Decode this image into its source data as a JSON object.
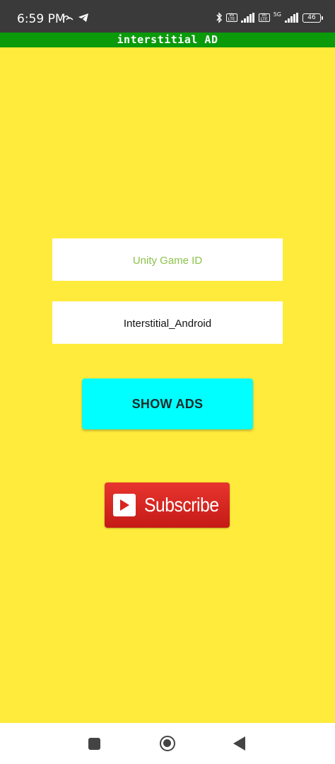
{
  "status_bar": {
    "time": "6:59 PM",
    "battery": "46",
    "network": "5G",
    "volte": "Vo LTE",
    "icons": [
      "signal-alt-icon",
      "telegram-icon",
      "bluetooth-icon",
      "volte-icon",
      "signal-bars-icon",
      "volte-icon",
      "5g-icon",
      "signal-bars-icon",
      "battery-icon"
    ]
  },
  "app": {
    "title": "interstitial AD",
    "title_bar_color": "#0a9a0a",
    "background_color": "#ffeb3b"
  },
  "form": {
    "game_id_placeholder": "Unity Game ID",
    "placement_value": "Interstitial_Android"
  },
  "buttons": {
    "show_ads": "SHOW ADS",
    "show_ads_color": "#00ffff",
    "subscribe": "Subscribe",
    "subscribe_color": "#d9261f"
  },
  "nav_bar": {
    "icons": [
      "recents-icon",
      "home-icon",
      "back-icon"
    ]
  }
}
